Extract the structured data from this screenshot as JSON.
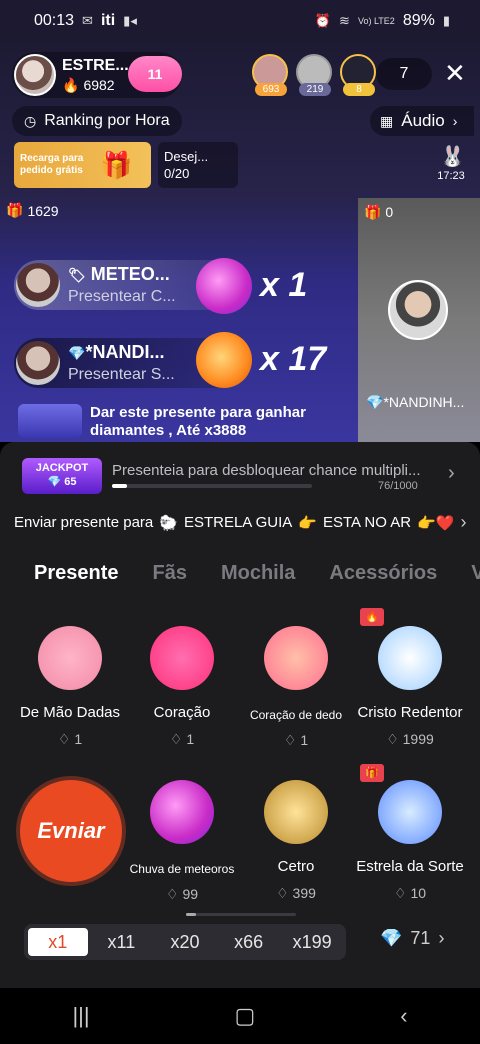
{
  "status_bar": {
    "time": "00:13",
    "carrier": "iti",
    "battery": "89%",
    "network": "Vo) LTE2"
  },
  "host": {
    "name": "ESTRE...",
    "coins": "6982",
    "badge": "11"
  },
  "viewers": [
    {
      "count": "693",
      "color": "#f7a33a"
    },
    {
      "count": "219",
      "color": "#6a6a9a"
    },
    {
      "count": "8",
      "color": "#f1c23b"
    }
  ],
  "viewer_total": "7",
  "ranking_label": "Ranking por Hora",
  "audio_label": "Áudio",
  "recharge_text": "Recarga para pedido grátis",
  "wish": {
    "title": "Desej...",
    "progress": "0/20"
  },
  "timer": "17:23",
  "left_stream": {
    "gifts": "1629"
  },
  "right_stream": {
    "gifts": "0",
    "name": "*NANDINH..."
  },
  "gift_feed": [
    {
      "name": "METEO...",
      "subtitle": "Presentear C...",
      "multiplier": "x 1"
    },
    {
      "name": "*NANDI...",
      "subtitle": "Presentear S...",
      "multiplier": "x 17"
    }
  ],
  "promo_text": "Dar este presente para ganhar diamantes , Até x3888",
  "jackpot": {
    "label": "JACKPOT",
    "value": "65",
    "text": "Presenteia para desbloquear chance multipli...",
    "progress_text": "76/1000",
    "progress": 0.076
  },
  "send_to": {
    "prefix": "Enviar presente para",
    "target": "ESTRELA GUIA",
    "suffix": "ESTA NO AR"
  },
  "tabs": [
    "Presente",
    "Fãs",
    "Mochila",
    "Acessórios",
    "V"
  ],
  "gifts": [
    {
      "name": "De Mão Dadas",
      "price": "1",
      "color": "#f59ab7"
    },
    {
      "name": "Coração",
      "price": "1",
      "color": "#ff3d8a"
    },
    {
      "name": "Coração de dedo",
      "price": "1",
      "color": "#ff8fa8"
    },
    {
      "name": "Cristo Redentor",
      "price": "1999",
      "color": "#bfe3ff"
    },
    {
      "name": "Chuva de meteoros",
      "price": "99",
      "color": "#e34bd6"
    },
    {
      "name": "Cetro",
      "price": "399",
      "color": "#d6a84c"
    },
    {
      "name": "Estrela da Sorte",
      "price": "10",
      "color": "#6fa8ff"
    }
  ],
  "send_button": "Evniar",
  "quantities": [
    "x1",
    "x11",
    "x20",
    "x66",
    "x199"
  ],
  "balance": "71"
}
